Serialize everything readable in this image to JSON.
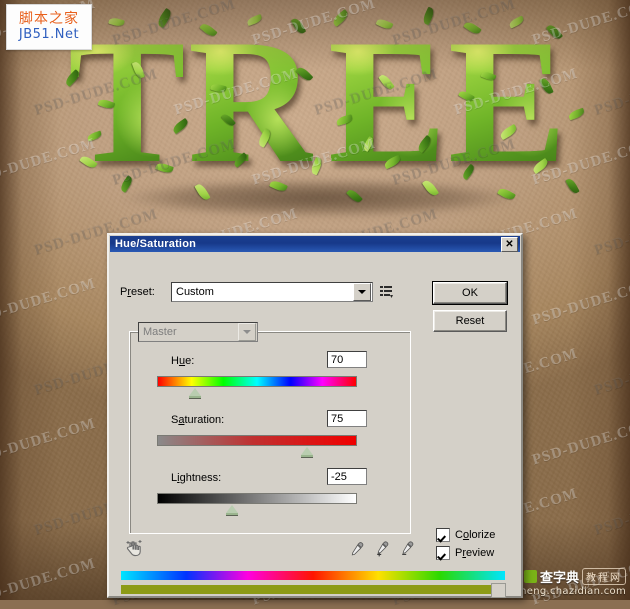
{
  "artwork": {
    "word": "TREE",
    "letters": [
      "T",
      "R",
      "E",
      "E"
    ],
    "style": "leafy-green-3d-text",
    "background_color": "#c0a081",
    "leaf_color": "#74b52c"
  },
  "watermarks": {
    "tiled_text": "PSD-DUDE.COM",
    "jb51": {
      "cn": "脚本之家",
      "en": "JB51.Net"
    },
    "chazidian": {
      "cn": "查字典",
      "boxed": "教程网",
      "url": "jiaocheng.chazidian.com"
    }
  },
  "dialog": {
    "title": "Hue/Saturation",
    "close_label": "✕",
    "preset": {
      "label": "Preset:",
      "label_parts": {
        "pre": "P",
        "underlined": "r",
        "post": "eset:"
      },
      "value": "Custom",
      "menu_icon": "preset-options-icon"
    },
    "buttons": {
      "ok": "OK",
      "reset": "Reset"
    },
    "channel": {
      "value": "Master",
      "disabled": true
    },
    "sliders": [
      {
        "id": "hue",
        "label": "Hue:",
        "label_parts": {
          "pre": "H",
          "underlined": "u",
          "post": "e:"
        },
        "value": "70",
        "range": [
          -180,
          180
        ],
        "thumb_percent": 19.4,
        "track": "hue-spectrum"
      },
      {
        "id": "saturation",
        "label": "Saturation:",
        "label_parts": {
          "pre": "S",
          "underlined": "a",
          "post": "turation:"
        },
        "value": "75",
        "range": [
          0,
          100
        ],
        "thumb_percent": 75,
        "track": "gray-to-red"
      },
      {
        "id": "lightness",
        "label": "Lightness:",
        "label_parts": {
          "pre": "L",
          "underlined": "i",
          "post": "ghtness:"
        },
        "value": "-25",
        "range": [
          -100,
          100
        ],
        "thumb_percent": 37.5,
        "track": "black-to-white"
      }
    ],
    "tools": {
      "on_image_adjust": "on-image-adjustment-tool-icon",
      "eyedroppers": [
        "eyedropper-icon",
        "eyedropper-plus-icon",
        "eyedropper-minus-icon"
      ]
    },
    "checkboxes": [
      {
        "id": "colorize",
        "label": "Colorize",
        "label_parts": {
          "pre": "C",
          "underlined": "o",
          "post": "lorize"
        },
        "checked": true
      },
      {
        "id": "preview",
        "label": "Preview",
        "label_parts": {
          "pre": "P",
          "underlined": "r",
          "post": "eview"
        },
        "checked": true
      }
    ],
    "color_bars": {
      "input_bar": "full-hue-spectrum",
      "output_bar_color": "#8d9b16"
    }
  }
}
